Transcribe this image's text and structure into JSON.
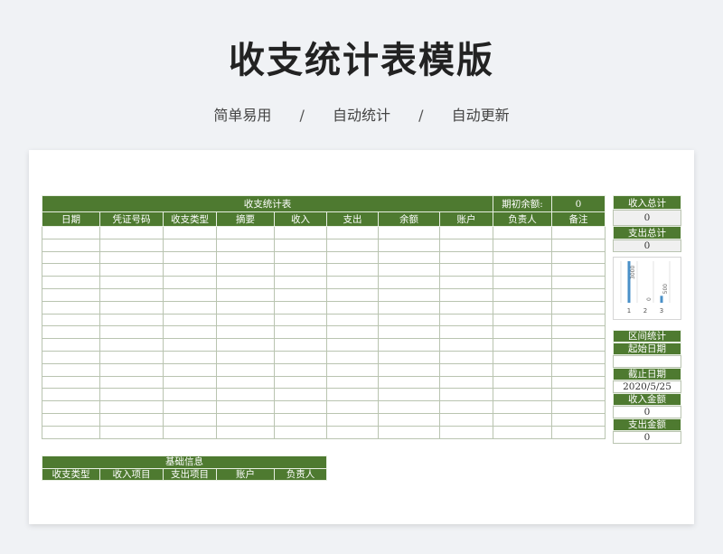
{
  "page": {
    "title": "收支统计表模版",
    "subtitle_items": [
      "简单易用",
      "自动统计",
      "自动更新"
    ],
    "separator": "/"
  },
  "main_table": {
    "title": "收支统计表",
    "opening_balance_label": "期初余额:",
    "opening_balance_value": "0",
    "columns": [
      "日期",
      "凭证号码",
      "收支类型",
      "摘要",
      "收入",
      "支出",
      "余额",
      "账户",
      "负责人",
      "备注"
    ],
    "empty_row_count": 17
  },
  "summary": {
    "income_total_label": "收入总计",
    "income_total_value": "0",
    "expense_total_label": "支出总计",
    "expense_total_value": "0"
  },
  "mini_chart": {
    "type": "bar",
    "categories": [
      "1",
      "2",
      "3"
    ],
    "values": [
      3000,
      0,
      500
    ],
    "data_labels": [
      "3000",
      "0",
      "500"
    ],
    "ylim": [
      0,
      3000
    ],
    "bar_color": "#4a90c8"
  },
  "interval_stats": {
    "title": "区间统计",
    "start_date_label": "起始日期",
    "start_date_value": "",
    "end_date_label": "截止日期",
    "end_date_value": "2020/5/25",
    "income_amount_label": "收入金额",
    "income_amount_value": "0",
    "expense_amount_label": "支出金额",
    "expense_amount_value": "0"
  },
  "base_info": {
    "title": "基础信息",
    "columns": [
      "收支类型",
      "收入项目",
      "支出项目",
      "账户",
      "负责人"
    ]
  },
  "colors": {
    "header_green": "#4e7a30",
    "background": "#f0f2f5"
  }
}
